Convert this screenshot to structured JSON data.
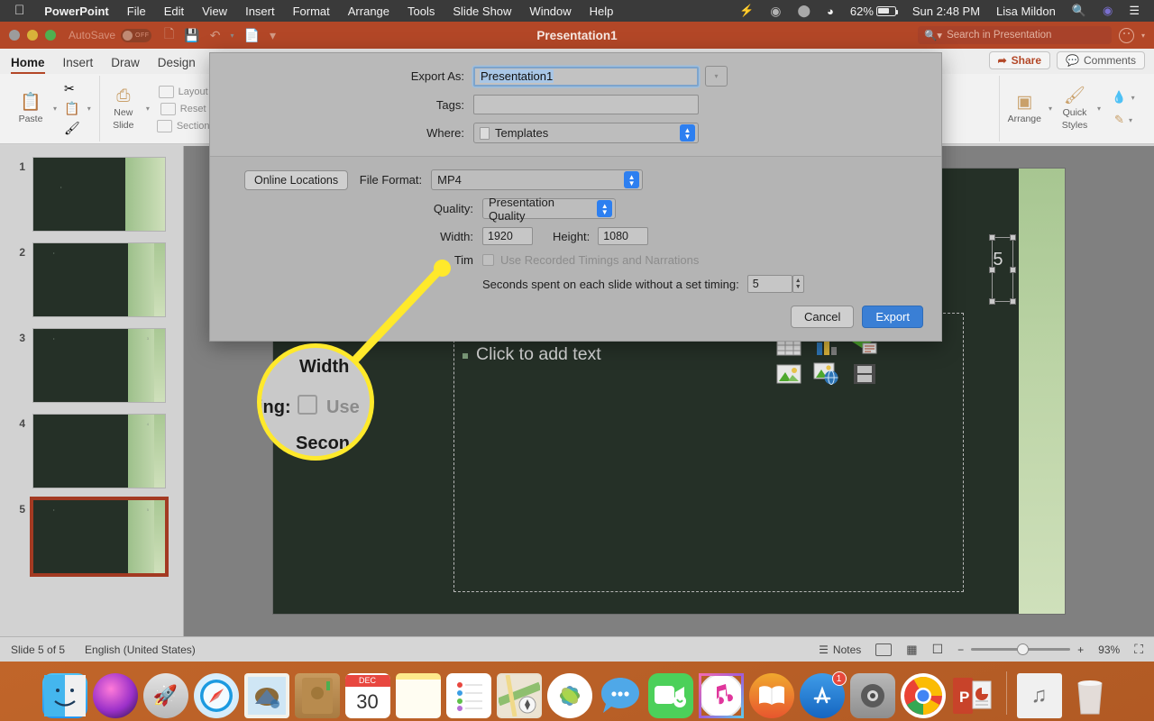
{
  "menubar": {
    "apple": "apple-logo",
    "items": [
      "PowerPoint",
      "File",
      "Edit",
      "View",
      "Insert",
      "Format",
      "Arrange",
      "Tools",
      "Slide Show",
      "Window",
      "Help"
    ],
    "battery_percent": "62%",
    "clock": "Sun 2:48 PM",
    "user": "Lisa Mildon"
  },
  "titlebar": {
    "autosave_label": "AutoSave",
    "autosave_state": "OFF",
    "document_title": "Presentation1",
    "search_placeholder": "Search in Presentation"
  },
  "ribbon": {
    "tabs": [
      {
        "label": "Home",
        "active": true
      },
      {
        "label": "Insert",
        "active": false
      },
      {
        "label": "Draw",
        "active": false
      },
      {
        "label": "Design",
        "active": false
      }
    ],
    "share_label": "Share",
    "comments_label": "Comments",
    "groups": {
      "paste": "Paste",
      "new_slide": "New\nSlide",
      "new_slide_line1": "New",
      "new_slide_line2": "Slide",
      "layout": "Layout",
      "reset": "Reset",
      "section": "Section",
      "arrange": "Arrange",
      "quick_styles_line1": "Quick",
      "quick_styles_line2": "Styles"
    }
  },
  "thumbnails": [
    {
      "number": "1"
    },
    {
      "number": "2"
    },
    {
      "number": "3"
    },
    {
      "number": "4"
    },
    {
      "number": "5",
      "selected": true
    }
  ],
  "slide": {
    "placeholder_text": "Click to add text",
    "slide_number": "5",
    "content_icons": [
      "table-icon",
      "chart-icon",
      "smartart-icon",
      "picture-icon",
      "online-picture-icon",
      "video-icon"
    ]
  },
  "statusbar": {
    "slide_count": "Slide 5 of 5",
    "language": "English (United States)",
    "notes_label": "Notes",
    "zoom_level": "93%",
    "zoom_out": "−",
    "zoom_in": "+"
  },
  "export_dialog": {
    "export_as_label": "Export As:",
    "export_as_value": "Presentation1",
    "tags_label": "Tags:",
    "tags_value": "",
    "where_label": "Where:",
    "where_value": "Templates",
    "online_locations_label": "Online Locations",
    "file_format_label": "File Format:",
    "file_format_value": "MP4",
    "quality_label": "Quality:",
    "quality_value": "Presentation Quality",
    "width_label": "Width:",
    "width_value": "1920",
    "height_label": "Height:",
    "height_value": "1080",
    "timing_label": "Timing:",
    "timing_label_truncated": "Tim",
    "use_recorded_label": "Use Recorded Timings and Narrations",
    "use_recorded_checked": false,
    "seconds_label": "Seconds spent on each slide without a set timing:",
    "seconds_value": "5",
    "cancel_label": "Cancel",
    "export_label": "Export"
  },
  "magnifier": {
    "line_top": "Width",
    "line_mid_label": "ing:",
    "line_mid_text": "Use",
    "line_bottom": "Secon"
  },
  "dock": {
    "items": [
      {
        "name": "finder",
        "badge": null,
        "running": true
      },
      {
        "name": "siri",
        "badge": null,
        "running": false
      },
      {
        "name": "launchpad",
        "badge": null,
        "running": false
      },
      {
        "name": "safari",
        "badge": null,
        "running": false
      },
      {
        "name": "mail",
        "badge": null,
        "running": false
      },
      {
        "name": "contacts",
        "badge": null,
        "running": false
      },
      {
        "name": "calendar",
        "badge": null,
        "running": false,
        "month": "DEC",
        "day": "30"
      },
      {
        "name": "notes",
        "badge": null,
        "running": false
      },
      {
        "name": "reminders",
        "badge": null,
        "running": false
      },
      {
        "name": "maps",
        "badge": null,
        "running": false
      },
      {
        "name": "photos",
        "badge": null,
        "running": false
      },
      {
        "name": "messages",
        "badge": null,
        "running": false
      },
      {
        "name": "facetime",
        "badge": null,
        "running": false
      },
      {
        "name": "itunes",
        "badge": null,
        "running": false
      },
      {
        "name": "books",
        "badge": null,
        "running": false
      },
      {
        "name": "app-store",
        "badge": "1",
        "running": false
      },
      {
        "name": "system-preferences",
        "badge": null,
        "running": false
      },
      {
        "name": "chrome",
        "badge": null,
        "running": true
      },
      {
        "name": "powerpoint",
        "badge": null,
        "running": true
      },
      {
        "name": "music-folder",
        "badge": null,
        "running": false
      },
      {
        "name": "trash",
        "badge": null,
        "running": false
      }
    ]
  },
  "colors": {
    "accent_red": "#b34727",
    "dialog_blue": "#3a7fd5",
    "callout_yellow": "#ffe92b",
    "slide_dark": "#253027",
    "slide_green": "#cfe0bb"
  }
}
